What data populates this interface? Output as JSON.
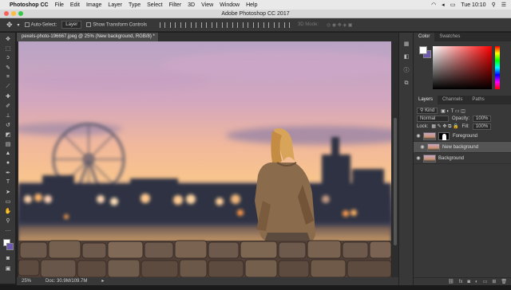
{
  "menubar": {
    "app_name": "Photoshop CC",
    "items": [
      "File",
      "Edit",
      "Image",
      "Layer",
      "Type",
      "Select",
      "Filter",
      "3D",
      "View",
      "Window",
      "Help"
    ],
    "clock": "Tue 10:10"
  },
  "window": {
    "title": "Adobe Photoshop CC 2017"
  },
  "options": {
    "auto_select_label": "Auto-Select:",
    "auto_select_value": "Layer",
    "transform_label": "Show Transform Controls",
    "mode_3d": "3D Mode:"
  },
  "document": {
    "tab_title": "pexels-photo-196667.jpeg @ 25% (New background, RGB/8) *",
    "zoom": "25%",
    "doc_size": "Doc: 30.9M/109.7M"
  },
  "color_panel": {
    "tabs": [
      "Color",
      "Swatches"
    ],
    "foreground": "#ffffff",
    "background": "#6d5ab0"
  },
  "layers_panel": {
    "tabs": [
      "Layers",
      "Channels",
      "Paths"
    ],
    "kind_label": "Kind",
    "blend_mode": "Normal",
    "opacity_label": "Opacity:",
    "opacity_value": "100%",
    "lock_label": "Lock:",
    "fill_label": "Fill:",
    "fill_value": "100%",
    "layers": [
      {
        "name": "Foreground"
      },
      {
        "name": "New background",
        "selected": true
      },
      {
        "name": "Background"
      }
    ]
  }
}
